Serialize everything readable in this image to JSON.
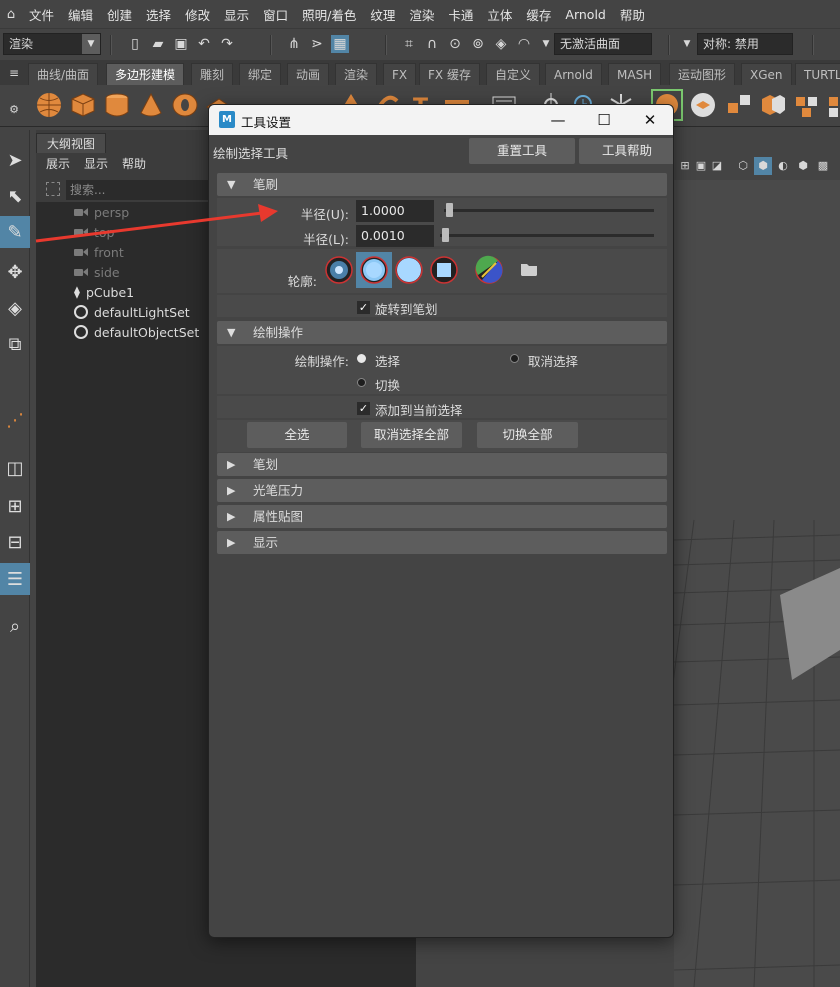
{
  "menubar": {
    "items": [
      "文件",
      "编辑",
      "创建",
      "选择",
      "修改",
      "显示",
      "窗口",
      "照明/着色",
      "纹理",
      "渲染",
      "卡通",
      "立体",
      "缓存",
      "Arnold",
      "帮助"
    ]
  },
  "toolbar": {
    "mode": "渲染",
    "live_surface": "无激活曲面",
    "symmetry": "对称: 禁用"
  },
  "shelf": {
    "tabs": [
      "曲线/曲面",
      "多边形建模",
      "雕刻",
      "绑定",
      "动画",
      "渲染",
      "FX",
      "FX 缓存",
      "自定义",
      "Arnold",
      "MASH",
      "运动图形",
      "XGen",
      "TURTL"
    ],
    "active_tab": "多边形建模"
  },
  "outliner": {
    "tab": "大纲视图",
    "menu": [
      "展示",
      "显示",
      "帮助"
    ],
    "search_placeholder": "搜索...",
    "items": [
      {
        "label": "persp",
        "type": "camera",
        "dim": true
      },
      {
        "label": "top",
        "type": "camera",
        "dim": true
      },
      {
        "label": "front",
        "type": "camera",
        "dim": true
      },
      {
        "label": "side",
        "type": "camera",
        "dim": true
      },
      {
        "label": "pCube1",
        "type": "mesh",
        "dim": false
      },
      {
        "label": "defaultLightSet",
        "type": "set",
        "dim": false
      },
      {
        "label": "defaultObjectSet",
        "type": "set",
        "dim": false
      }
    ]
  },
  "dialog": {
    "logo": "M",
    "title": "工具设置",
    "tool_name": "绘制选择工具",
    "reset_button": "重置工具",
    "help_button": "工具帮助",
    "brush": {
      "header": "笔刷",
      "radius_u_label": "半径(U):",
      "radius_u_value": "1.0000",
      "radius_u_fraction": 0.0,
      "radius_l_label": "半径(L):",
      "radius_l_value": "0.0010",
      "radius_l_fraction": 0.0,
      "profile_label": "轮廓:",
      "rotate_label": "旋转到笔划",
      "rotate_checked": true
    },
    "paint_ops": {
      "header": "绘制操作",
      "ops_label": "绘制操作:",
      "select": "选择",
      "deselect": "取消选择",
      "toggle": "切换",
      "add_label": "添加到当前选择",
      "add_checked": true,
      "select_all": "全选",
      "deselect_all": "取消选择全部",
      "toggle_all": "切换全部"
    },
    "collapsed_sections": [
      "笔划",
      "光笔压力",
      "属性贴图",
      "显示"
    ]
  },
  "colors": {
    "accent": "#5285a6",
    "annotation_arrow": "#e8392e"
  }
}
